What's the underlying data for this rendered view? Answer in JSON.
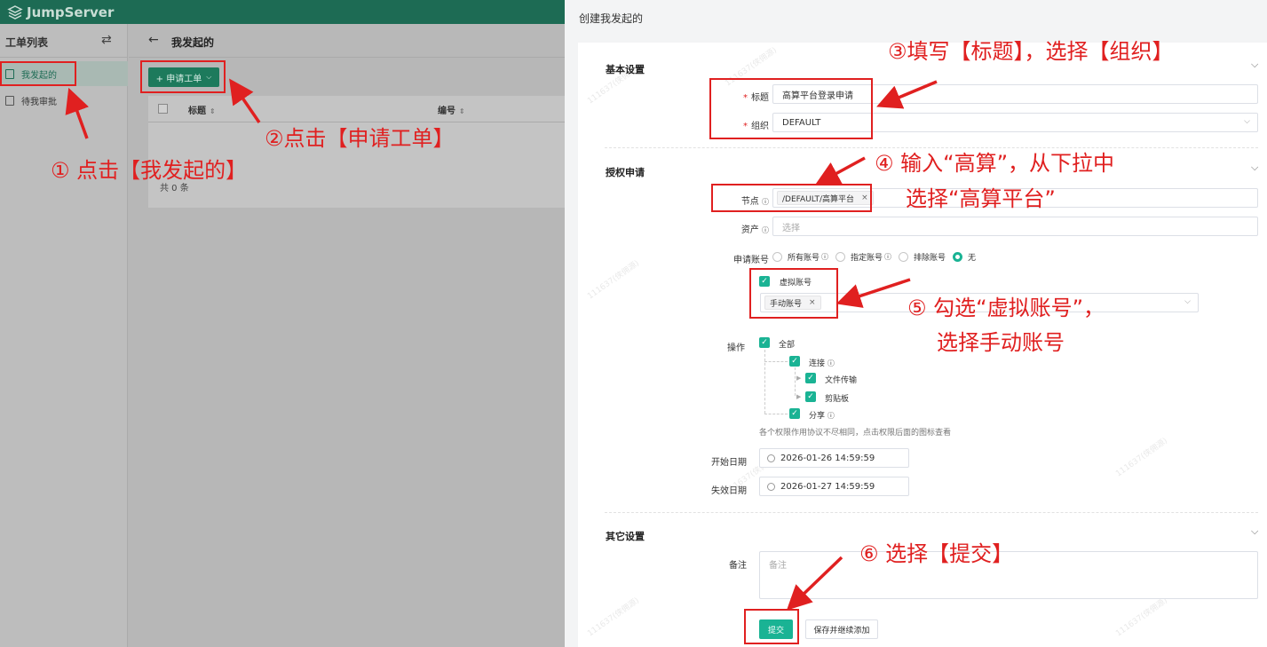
{
  "app": {
    "brand": "JumpServer"
  },
  "sidebar": {
    "title": "工单列表",
    "items": [
      {
        "label": "我发起的",
        "active": true
      },
      {
        "label": "待我审批",
        "active": false
      }
    ]
  },
  "main": {
    "title": "我发起的",
    "apply_button": "+ 申请工单",
    "table": {
      "columns": [
        "标题",
        "编号"
      ],
      "total": "共 0 条"
    }
  },
  "drawer": {
    "title": "创建我发起的",
    "basic": {
      "section": "基本设置",
      "title_label": "标题",
      "title_value": "高算平台登录申请",
      "org_label": "组织",
      "org_value": "DEFAULT"
    },
    "auth": {
      "section": "授权申请",
      "node_label": "节点",
      "node_tag": "/DEFAULT/高算平台",
      "asset_label": "资产",
      "asset_placeholder": "选择",
      "account_label": "申请账号",
      "account_options": [
        "所有账号",
        "指定账号",
        "排除账号",
        "无"
      ],
      "account_selected": "无",
      "virtual_label": "虚拟账号",
      "manual_tag": "手动账号",
      "actions_label": "操作",
      "actions": {
        "all": "全部",
        "connect": "连接",
        "file_transfer": "文件传输",
        "clipboard": "剪贴板",
        "share": "分享"
      },
      "actions_hint": "各个权限作用协议不尽相同，点击权限后面的图标查看",
      "start_label": "开始日期",
      "start_value": "2026-01-26 14:59:59",
      "end_label": "失效日期",
      "end_value": "2026-01-27 14:59:59"
    },
    "other": {
      "section": "其它设置",
      "remark_label": "备注",
      "remark_placeholder": "备注"
    },
    "buttons": {
      "submit": "提交",
      "save_continue": "保存并继续添加"
    },
    "watermark": "111637(侠佣源)"
  },
  "annotations": {
    "step1": "① 点击【我发起的】",
    "step2": "②点击【申请工单】",
    "step3": "③填写【标题】，选择【组织】",
    "step4_line1": "④ 输入“高算”，从下拉中",
    "step4_line2": "选择“高算平台”",
    "step5_line1": "⑤ 勾选“虚拟账号”，",
    "step5_line2": "选择手动账号",
    "step6": "⑥ 选择【提交】",
    "color": "#e02020"
  },
  "colors": {
    "brand": "#1ab394",
    "topbar": "#1d6b54",
    "annotation": "#e02020"
  }
}
